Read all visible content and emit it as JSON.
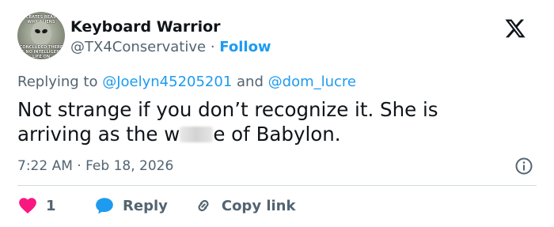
{
  "author": {
    "name": "Keyboard Warrior",
    "handle": "@TX4Conservative",
    "separator": "·",
    "follow_label": "Follow",
    "avatar_caption_top": "SOCRATES REASON WHY ALIENS",
    "avatar_caption_bottom": "CONCLUDED THERE IS NO INTELLIGENT LIFE ON"
  },
  "reply_context": {
    "prefix": "Replying to",
    "mention_1": "@Joelyn45205201",
    "conjunction": "and",
    "mention_2": "@dom_lucre"
  },
  "tweet": {
    "line1": "Not strange if you don’t recognize it.  She is",
    "line2_start": "arriving as the w",
    "line2_end": "e of Babylon.",
    "timestamp": "7:22 AM · Feb 18, 2026"
  },
  "actions": {
    "like_count": "1",
    "reply_label": "Reply",
    "copy_label": "Copy link"
  },
  "icons": {
    "brand": "x-logo-icon",
    "info": "info-icon",
    "like": "heart-icon",
    "reply": "speech-bubble-icon",
    "copy": "link-icon"
  },
  "colors": {
    "text": "#0f1419",
    "secondary": "#536471",
    "accent": "#1d9bf0",
    "like": "#f91880",
    "divider": "#cfd9de"
  }
}
